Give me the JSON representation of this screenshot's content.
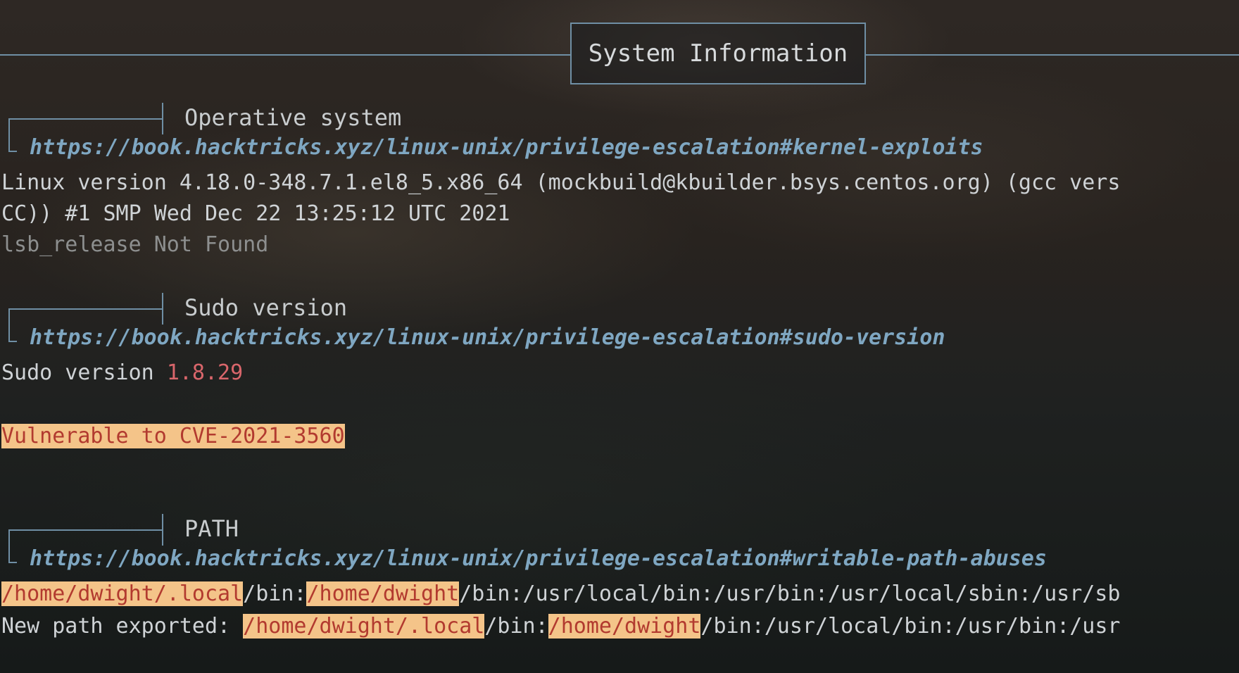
{
  "header": {
    "title": "System Information"
  },
  "sections": {
    "os": {
      "title": "Operative system",
      "link": "https://book.hacktricks.xyz/linux-unix/privilege-escalation#kernel-exploits",
      "kernel_line1": "Linux version 4.18.0-348.7.1.el8_5.x86_64 (mockbuild@kbuilder.bsys.centos.org) (gcc vers",
      "kernel_line2": "CC)) #1 SMP Wed Dec 22 13:25:12 UTC 2021",
      "lsb_release": "lsb_release Not Found"
    },
    "sudo": {
      "title": "Sudo version",
      "link": "https://book.hacktricks.xyz/linux-unix/privilege-escalation#sudo-version",
      "label": "Sudo version ",
      "version": "1.8.29",
      "vuln": "Vulnerable to CVE-2021-3560"
    },
    "path": {
      "title": "PATH",
      "link": "https://book.hacktricks.xyz/linux-unix/privilege-escalation#writable-path-abuses",
      "line1": {
        "hl1": "/home/dwight/.local",
        "t1": "/bin:",
        "hl2": "/home/dwight",
        "t2": "/bin:/usr/local/bin:/usr/bin:/usr/local/sbin:/usr/sb"
      },
      "line2": {
        "prefix": "New path exported: ",
        "hl1": "/home/dwight/.local",
        "t1": "/bin:",
        "hl2": "/home/dwight",
        "t2": "/bin:/usr/local/bin:/usr/bin:/usr"
      }
    }
  }
}
